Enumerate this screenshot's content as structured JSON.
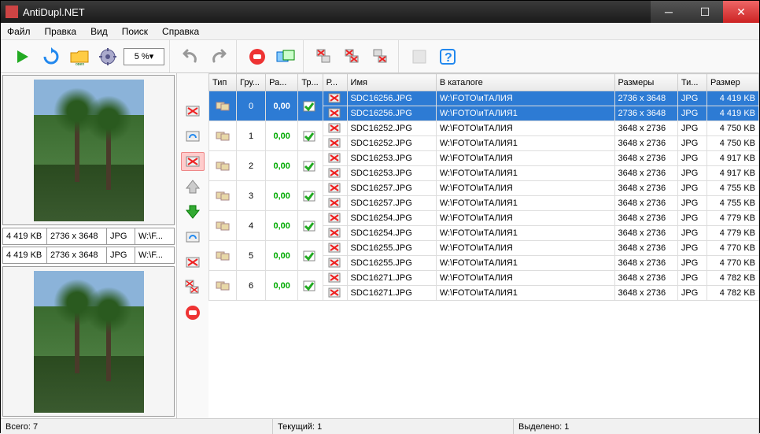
{
  "window": {
    "title": "AntiDupl.NET"
  },
  "menu": {
    "file": "Файл",
    "edit": "Правка",
    "view": "Вид",
    "search": "Поиск",
    "help": "Справка"
  },
  "toolbar": {
    "zoom": "5 %"
  },
  "preview": {
    "top": {
      "size": "4 419 KB",
      "dim": "2736 x 3648",
      "type": "JPG",
      "path": "W:\\F..."
    },
    "bottom": {
      "size": "4 419 KB",
      "dim": "2736 x 3648",
      "type": "JPG",
      "path": "W:\\F..."
    }
  },
  "columns": {
    "type": "Тип",
    "group": "Гру...",
    "diff": "Ра...",
    "tr": "Тр...",
    "r": "Р...",
    "name": "Имя",
    "path": "В каталоге",
    "dim": "Размеры",
    "ext": "Ти...",
    "size": "Размер"
  },
  "rows": [
    {
      "selected": true,
      "group": 0,
      "diff": "0,00",
      "a": {
        "name": "SDC16256.JPG",
        "path": "W:\\FOTO\\иТАЛИЯ",
        "dim": "2736 x 3648",
        "ext": "JPG",
        "size": "4 419 KB"
      },
      "b": {
        "name": "SDC16256.JPG",
        "path": "W:\\FOTO\\иТАЛИЯ1",
        "dim": "2736 x 3648",
        "ext": "JPG",
        "size": "4 419 KB"
      }
    },
    {
      "selected": false,
      "group": 1,
      "diff": "0,00",
      "a": {
        "name": "SDC16252.JPG",
        "path": "W:\\FOTO\\иТАЛИЯ",
        "dim": "3648 x 2736",
        "ext": "JPG",
        "size": "4 750 KB"
      },
      "b": {
        "name": "SDC16252.JPG",
        "path": "W:\\FOTO\\иТАЛИЯ1",
        "dim": "3648 x 2736",
        "ext": "JPG",
        "size": "4 750 KB"
      }
    },
    {
      "selected": false,
      "group": 2,
      "diff": "0,00",
      "a": {
        "name": "SDC16253.JPG",
        "path": "W:\\FOTO\\иТАЛИЯ",
        "dim": "3648 x 2736",
        "ext": "JPG",
        "size": "4 917 KB"
      },
      "b": {
        "name": "SDC16253.JPG",
        "path": "W:\\FOTO\\иТАЛИЯ1",
        "dim": "3648 x 2736",
        "ext": "JPG",
        "size": "4 917 KB"
      }
    },
    {
      "selected": false,
      "group": 3,
      "diff": "0,00",
      "a": {
        "name": "SDC16257.JPG",
        "path": "W:\\FOTO\\иТАЛИЯ",
        "dim": "3648 x 2736",
        "ext": "JPG",
        "size": "4 755 KB"
      },
      "b": {
        "name": "SDC16257.JPG",
        "path": "W:\\FOTO\\иТАЛИЯ1",
        "dim": "3648 x 2736",
        "ext": "JPG",
        "size": "4 755 KB"
      }
    },
    {
      "selected": false,
      "group": 4,
      "diff": "0,00",
      "a": {
        "name": "SDC16254.JPG",
        "path": "W:\\FOTO\\иТАЛИЯ",
        "dim": "3648 x 2736",
        "ext": "JPG",
        "size": "4 779 KB"
      },
      "b": {
        "name": "SDC16254.JPG",
        "path": "W:\\FOTO\\иТАЛИЯ1",
        "dim": "3648 x 2736",
        "ext": "JPG",
        "size": "4 779 KB"
      }
    },
    {
      "selected": false,
      "group": 5,
      "diff": "0,00",
      "a": {
        "name": "SDC16255.JPG",
        "path": "W:\\FOTO\\иТАЛИЯ",
        "dim": "3648 x 2736",
        "ext": "JPG",
        "size": "4 770 KB"
      },
      "b": {
        "name": "SDC16255.JPG",
        "path": "W:\\FOTO\\иТАЛИЯ1",
        "dim": "3648 x 2736",
        "ext": "JPG",
        "size": "4 770 KB"
      }
    },
    {
      "selected": false,
      "group": 6,
      "diff": "0,00",
      "a": {
        "name": "SDC16271.JPG",
        "path": "W:\\FOTO\\иТАЛИЯ",
        "dim": "3648 x 2736",
        "ext": "JPG",
        "size": "4 782 KB"
      },
      "b": {
        "name": "SDC16271.JPG",
        "path": "W:\\FOTO\\иТАЛИЯ1",
        "dim": "3648 x 2736",
        "ext": "JPG",
        "size": "4 782 KB"
      }
    }
  ],
  "status": {
    "total": "Всего: 7",
    "current": "Текущий: 1",
    "selected": "Выделено: 1"
  }
}
